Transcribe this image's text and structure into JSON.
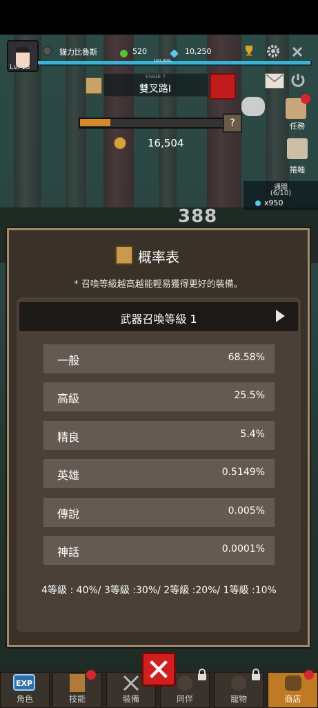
{
  "player": {
    "level": "Lv. 15",
    "name": "貓力比魯斯",
    "green_currency": "520",
    "diamonds": "10,250",
    "exp_percent": "100.00%"
  },
  "stage": {
    "label": "STAGE 7",
    "name": "雙叉路Ⅰ"
  },
  "gold": "16,504",
  "pass": {
    "title": "通關",
    "count": "(6/10)",
    "reward": "x950"
  },
  "damage_text": "388",
  "side_buttons": {
    "quest": "任務",
    "scroll": "捲軸"
  },
  "modal": {
    "title": "概率表",
    "note": "* 召喚等級越高越能輕易獲得更好的裝備。",
    "level_label": "武器召喚等級 1",
    "rows": [
      {
        "name": "一般",
        "value": "68.58%"
      },
      {
        "name": "高級",
        "value": "25.5%"
      },
      {
        "name": "精良",
        "value": "5.4%"
      },
      {
        "name": "英雄",
        "value": "0.5149%"
      },
      {
        "name": "傳說",
        "value": "0.005%"
      },
      {
        "name": "神話",
        "value": "0.0001%"
      }
    ],
    "footnote": "4等級 : 40%/ 3等級 :30%/ 2等級 :20%/ 1等級 :10%"
  },
  "close_symbol": "✕",
  "nav": {
    "tabs": [
      "角色",
      "技能",
      "裝備",
      "同伴",
      "寵物",
      "商店"
    ]
  },
  "icons": {
    "exp": "EXP",
    "question": "?"
  },
  "colors": {
    "accent_red": "#d11e1e",
    "panel": "#3a3129",
    "row": "#645a52",
    "exp_bar": "#38b4d6",
    "progress": "#d48a2a"
  }
}
